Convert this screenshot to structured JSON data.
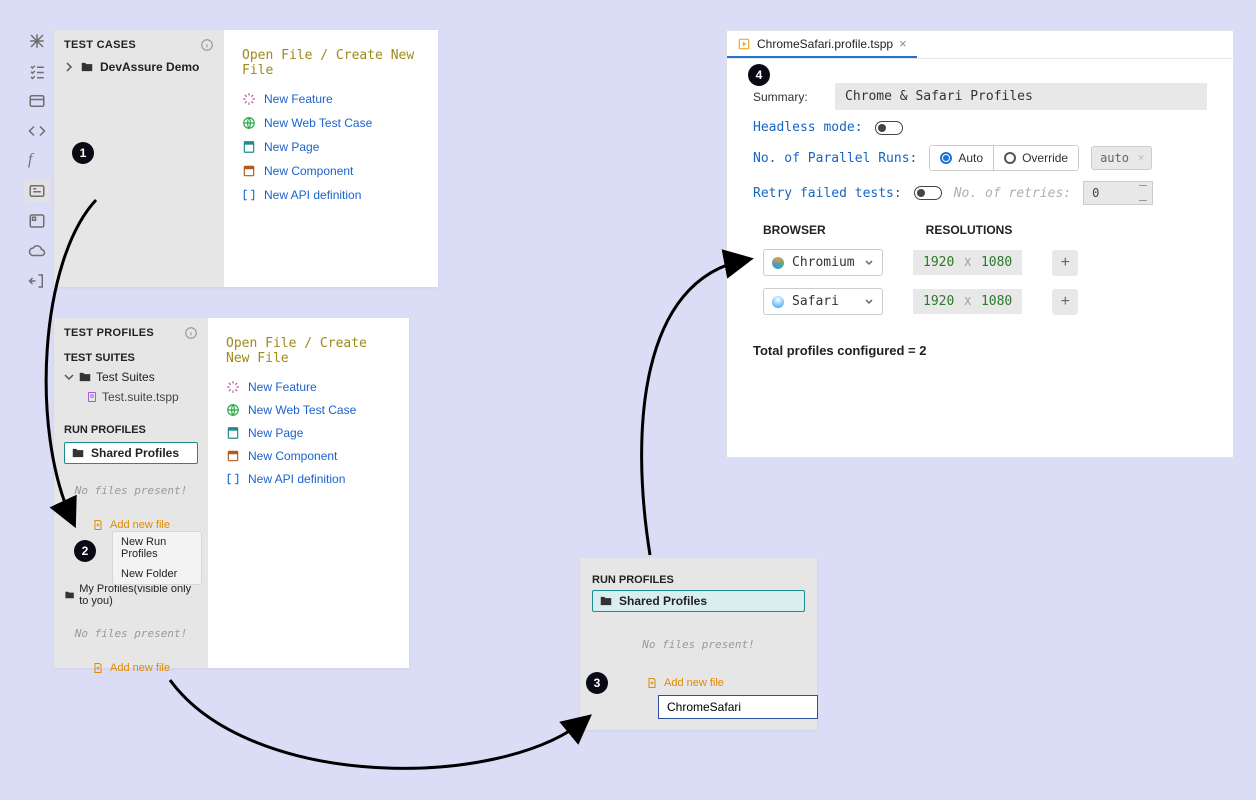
{
  "sidebar": {
    "tooltip": "Test Profiles"
  },
  "panel1": {
    "header": "TEST CASES",
    "project": "DevAssure Demo",
    "open_title": "Open File / Create New File",
    "items": [
      {
        "label": "New Feature",
        "icon": "sparkle-icon",
        "color": "#c64aa6"
      },
      {
        "label": "New Web Test Case",
        "icon": "globe-icon",
        "color": "#29a745"
      },
      {
        "label": "New Page",
        "icon": "page-icon",
        "color": "#1f8b8b"
      },
      {
        "label": "New Component",
        "icon": "component-icon",
        "color": "#b05c1d"
      },
      {
        "label": "New API definition",
        "icon": "api-icon",
        "color": "#1d73d6"
      }
    ]
  },
  "panel2": {
    "header": "TEST PROFILES",
    "suites_title": "TEST SUITES",
    "suites_root": "Test Suites",
    "suite_file": "Test.suite.tspp",
    "run_title": "RUN PROFILES",
    "shared": "Shared Profiles",
    "empty": "No files present!",
    "add": "Add new file",
    "ctx": [
      "New Run Profiles",
      "New Folder"
    ],
    "my_profiles": "My Profiles(visible only to you)",
    "open_title": "Open File / Create New File"
  },
  "panel3": {
    "run_title": "RUN PROFILES",
    "shared": "Shared Profiles",
    "empty": "No files present!",
    "add": "Add new file",
    "input": "ChromeSafari"
  },
  "panel4": {
    "tab": "ChromeSafari.profile.tspp",
    "summary_label": "Summary:",
    "summary_value": "Chrome & Safari Profiles",
    "headless_label": "Headless mode:",
    "parallel_label": "No. of Parallel Runs:",
    "parallel_opts": [
      "Auto",
      "Override"
    ],
    "parallel_sel": "auto",
    "retry_label": "Retry failed tests:",
    "retry_count_label": "No. of retries:",
    "retry_value": "0",
    "col_browser": "BROWSER",
    "col_res": "RESOLUTIONS",
    "rows": [
      {
        "name": "Chromium",
        "dot": "#3b7cf4",
        "w": "1920",
        "h": "1080"
      },
      {
        "name": "Safari",
        "dot": "#1e9cf0",
        "w": "1920",
        "h": "1080"
      }
    ],
    "total": "Total profiles configured = 2"
  },
  "steps": {
    "1": "1",
    "2": "2",
    "3": "3",
    "4": "4"
  }
}
